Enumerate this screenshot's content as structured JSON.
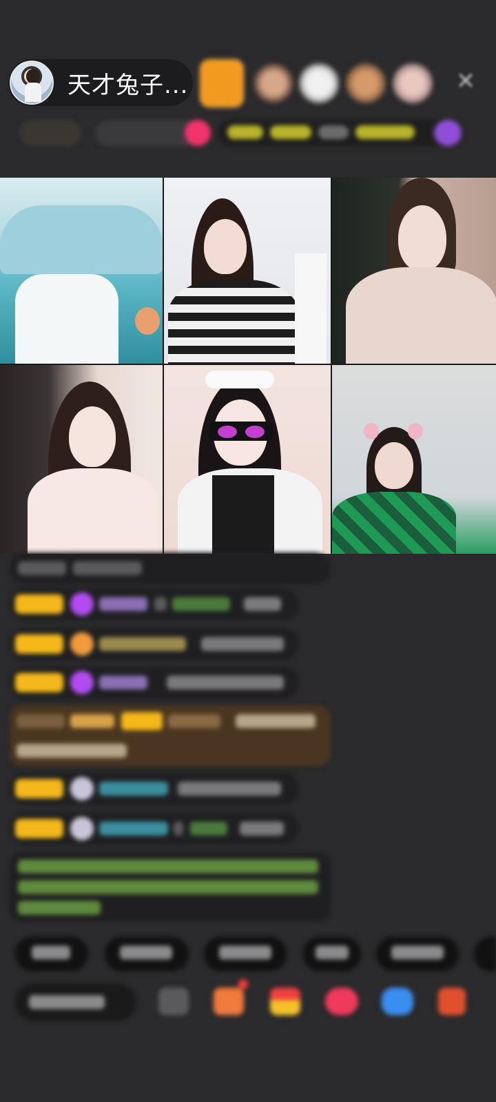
{
  "header": {
    "host_name": "天才兔子...",
    "close_icon": "close-icon"
  },
  "colors": {
    "background": "#2a2a2c",
    "pill": "#1c1c1e",
    "badge_yellow": "#f4b81a",
    "gem_purple": "#b24cf0",
    "gem_orange": "#f09a3c",
    "system_green": "#8ecf5a",
    "cyan_name": "#4fc6d8"
  },
  "grid": {
    "tiles": [
      "tile-1",
      "tile-2",
      "tile-3",
      "tile-4",
      "tile-5",
      "tile-6"
    ]
  }
}
